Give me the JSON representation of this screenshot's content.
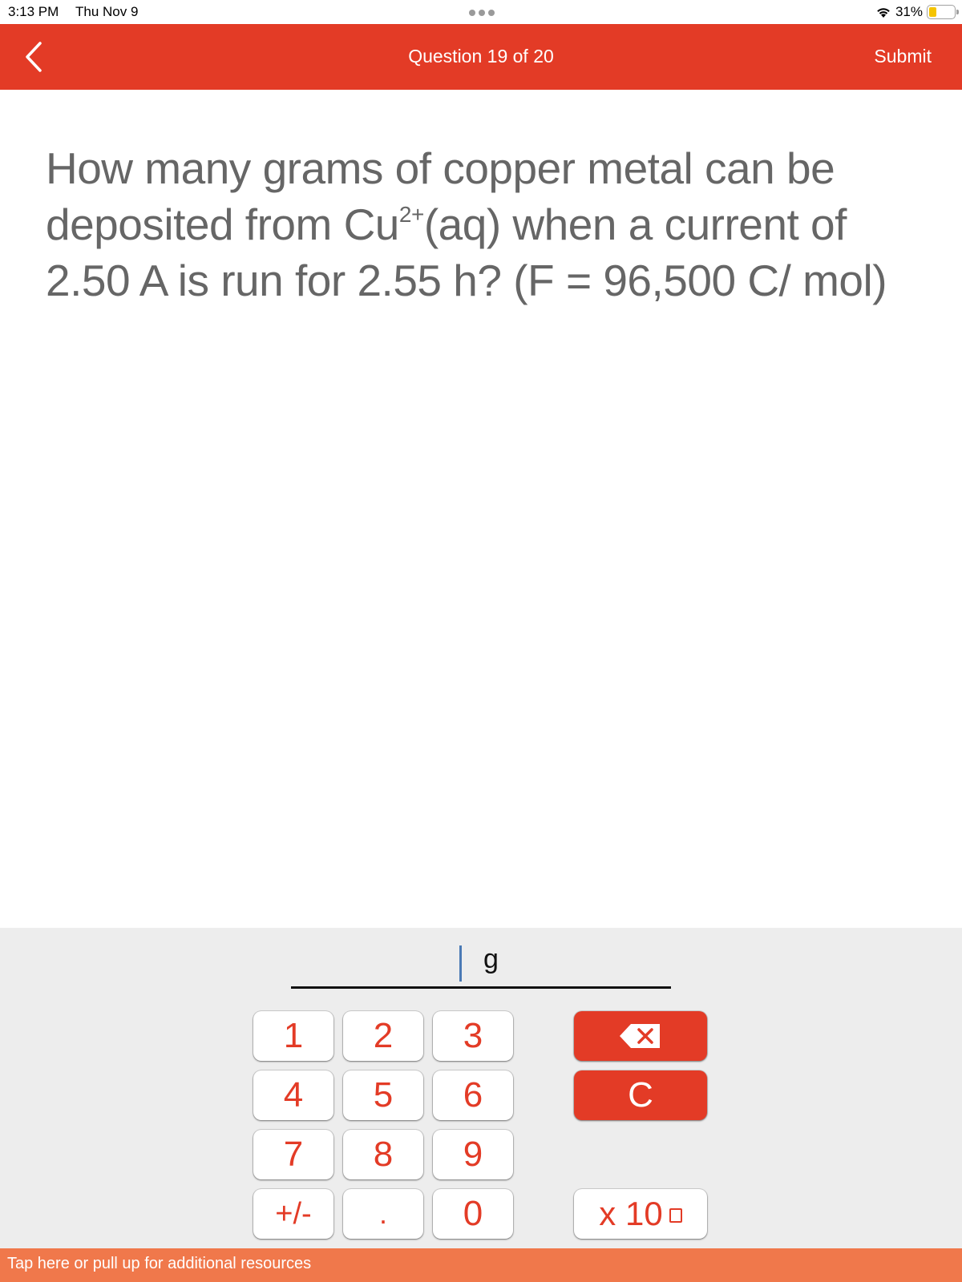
{
  "status_bar": {
    "time": "3:13 PM",
    "date": "Thu Nov 9",
    "battery_percent": "31%",
    "battery_level": 0.31,
    "icons": [
      "wifi-icon",
      "battery-icon",
      "more-dots-icon"
    ]
  },
  "nav": {
    "back_icon": "chevron-left-icon",
    "title": "Question 19 of 20",
    "submit_label": "Submit"
  },
  "question": {
    "text_before": "How many grams of copper metal can be deposited  from Cu",
    "superscript": "2+",
    "text_after": "(aq) when a current of 2.50 A is run for 2.55 h? (F = 96,500 C/ mol)"
  },
  "answer": {
    "value": "",
    "unit": "g"
  },
  "keypad": {
    "digits": [
      "1",
      "2",
      "3",
      "4",
      "5",
      "6",
      "7",
      "8",
      "9"
    ],
    "sign_label": "+/-",
    "decimal_label": ".",
    "zero_label": "0",
    "backspace_icon": "backspace-icon",
    "clear_label": "C",
    "sci_label": "x 10"
  },
  "colors": {
    "brand_red": "#e33b26",
    "resources_orange": "#f0784b",
    "question_text": "#666666",
    "panel_bg": "#ededed"
  },
  "resources": {
    "label": "Tap here or pull up for additional resources"
  }
}
